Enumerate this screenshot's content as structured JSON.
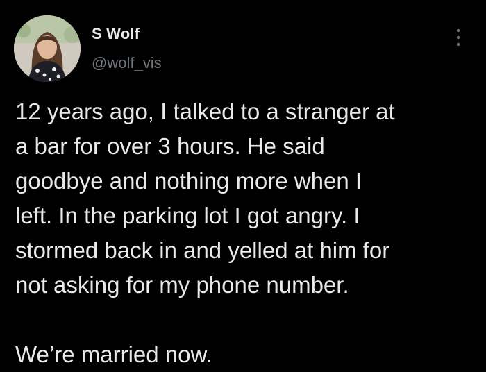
{
  "author": {
    "display_name": "S Wolf",
    "handle": "@wolf_vis",
    "avatar_icon": "profile-photo"
  },
  "menu": {
    "icon": "more-vertical-icon"
  },
  "tweet": {
    "lines": [
      "12 years ago, I talked to a stranger at",
      "a bar for over 3 hours. He said",
      "goodbye and nothing more when I",
      "left. In the parking lot I got angry. I",
      "stormed back in and yelled at him for",
      "not asking for my phone number.",
      "We’re married now."
    ]
  },
  "colors": {
    "background": "#000000",
    "primary_text": "#e7e9ea",
    "secondary_text": "#71767b"
  }
}
